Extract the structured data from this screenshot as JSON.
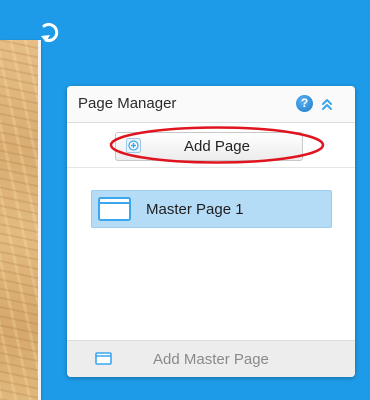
{
  "page_manager": {
    "title": "Page Manager",
    "help_icon": "?",
    "add_page_label": "Add Page",
    "pages": [
      {
        "label": "Master Page 1",
        "selected": true
      }
    ],
    "add_master_label": "Add Master Page"
  },
  "colors": {
    "canvas_blue": "#1e9be8",
    "selected_item": "#b5dcf7",
    "annotation_red": "#e0141e",
    "accent_icon": "#3aa7ef"
  },
  "icons": {
    "redo": "redo-icon",
    "help": "help-icon",
    "collapse": "chevron-double-up-icon",
    "add": "plus-circle-icon",
    "page_thumb": "page-thumbnail-icon",
    "master_page": "master-page-icon"
  }
}
